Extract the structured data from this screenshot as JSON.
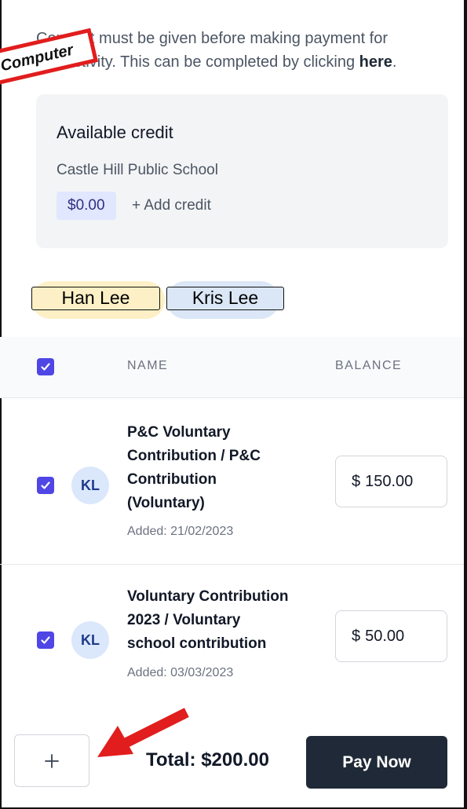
{
  "consent": {
    "line1": "Consent must be given before making payment for",
    "line2_prefix": "this activity. This can be completed by clicking ",
    "link": "here",
    "line2_suffix": "."
  },
  "annotation": {
    "sticker": "Computer"
  },
  "credit": {
    "title": "Available credit",
    "school": "Castle Hill Public School",
    "amount": "$0.00",
    "add_label": "+ Add credit"
  },
  "students": [
    {
      "name": "Han Lee",
      "color": "#fdf0c6"
    },
    {
      "name": "Kris Lee",
      "color": "#dbe7f7"
    }
  ],
  "table": {
    "headers": {
      "name": "NAME",
      "balance": "BALANCE"
    },
    "rows": [
      {
        "initials": "KL",
        "name_lines": [
          "P&C Voluntary",
          "Contribution / P&C",
          "Contribution",
          "(Voluntary)"
        ],
        "added": "Added: 21/02/2023",
        "currency": "$",
        "amount": "150.00",
        "checked": true
      },
      {
        "initials": "KL",
        "name_lines": [
          "Voluntary Contribution",
          "2023 / Voluntary",
          "school contribution"
        ],
        "added": "Added: 03/03/2023",
        "currency": "$",
        "amount": "50.00",
        "checked": true
      }
    ]
  },
  "footer": {
    "plus_icon": "plus-icon",
    "total": "Total: $200.00",
    "pay_label": "Pay Now"
  },
  "colors": {
    "accent": "#4f46e5",
    "dark_button": "#1f2937",
    "annotation_red": "#e11d1d"
  }
}
